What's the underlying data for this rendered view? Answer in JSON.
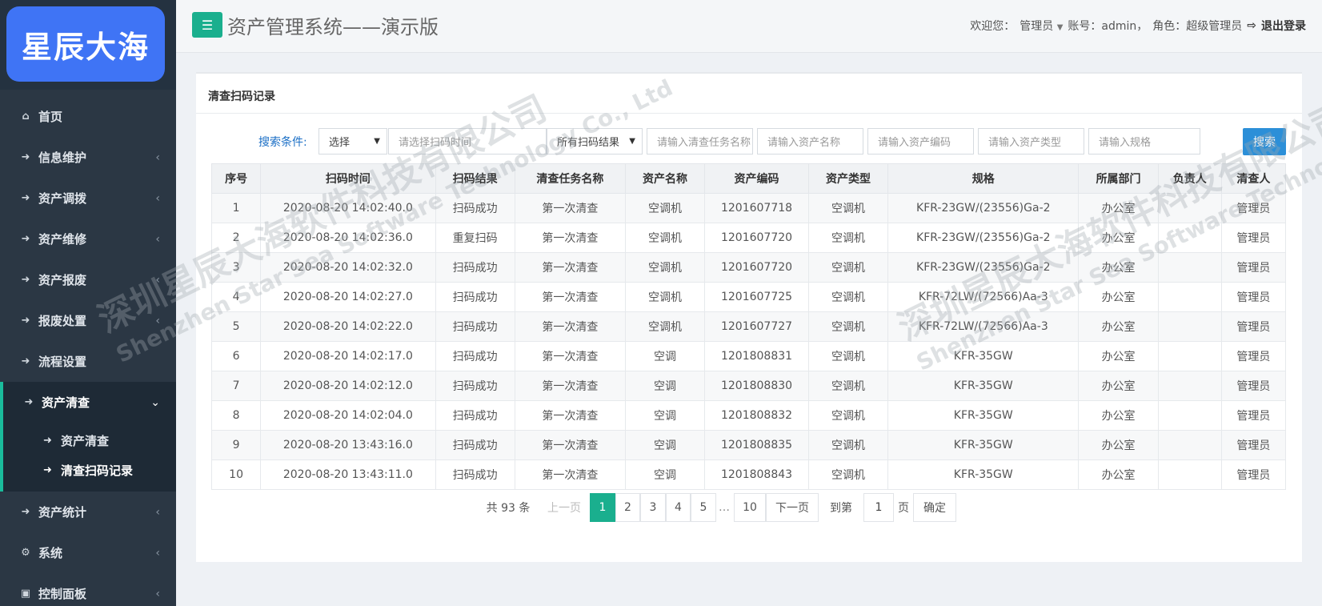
{
  "app": {
    "logo_text": "星辰大海",
    "title": "资产管理系统——演示版"
  },
  "header": {
    "welcome_prefix": "欢迎您：",
    "user_name": "管理员",
    "account_text": "账号：admin，",
    "role_text": "角色：超级管理员",
    "logout_label": "退出登录"
  },
  "sidebar": {
    "items": [
      {
        "label": "首页",
        "icon": "home-icon"
      },
      {
        "label": "信息维护",
        "icon": "arrow-right-icon"
      },
      {
        "label": "资产调拨",
        "icon": "arrow-right-icon"
      },
      {
        "label": "资产维修",
        "icon": "arrow-right-icon"
      },
      {
        "label": "资产报废",
        "icon": "arrow-right-icon"
      },
      {
        "label": "报废处置",
        "icon": "arrow-right-icon"
      },
      {
        "label": "流程设置",
        "icon": "arrow-right-icon"
      },
      {
        "label": "资产清查",
        "icon": "arrow-right-icon",
        "expanded": true
      },
      {
        "label": "资产统计",
        "icon": "arrow-right-icon"
      },
      {
        "label": "系统",
        "icon": "gear-icon"
      },
      {
        "label": "控制面板",
        "icon": "monitor-icon"
      }
    ],
    "sub_items": [
      {
        "label": "资产清查"
      },
      {
        "label": "清查扫码记录",
        "current": true
      }
    ]
  },
  "panel": {
    "title": "清查扫码记录"
  },
  "search": {
    "label": "搜索条件:",
    "select_value": "选择",
    "time_placeholder": "请选择扫码时间",
    "result_select_value": "所有扫码结果",
    "task_placeholder": "请输入清查任务名称",
    "asset_name_placeholder": "请输入资产名称",
    "asset_code_placeholder": "请输入资产编码",
    "asset_type_placeholder": "请输入资产类型",
    "spec_placeholder": "请输入规格",
    "button_label": "搜索"
  },
  "table": {
    "columns": [
      "序号",
      "扫码时间",
      "扫码结果",
      "清查任务名称",
      "资产名称",
      "资产编码",
      "资产类型",
      "规格",
      "所属部门",
      "负责人",
      "清查人"
    ],
    "rows": [
      [
        "1",
        "2020-08-20 14:02:40.0",
        "扫码成功",
        "第一次清查",
        "空调机",
        "1201607718",
        "空调机",
        "KFR-23GW/(23556)Ga-2",
        "办公室",
        "",
        "管理员"
      ],
      [
        "2",
        "2020-08-20 14:02:36.0",
        "重复扫码",
        "第一次清查",
        "空调机",
        "1201607720",
        "空调机",
        "KFR-23GW/(23556)Ga-2",
        "办公室",
        "",
        "管理员"
      ],
      [
        "3",
        "2020-08-20 14:02:32.0",
        "扫码成功",
        "第一次清查",
        "空调机",
        "1201607720",
        "空调机",
        "KFR-23GW/(23556)Ga-2",
        "办公室",
        "",
        "管理员"
      ],
      [
        "4",
        "2020-08-20 14:02:27.0",
        "扫码成功",
        "第一次清查",
        "空调机",
        "1201607725",
        "空调机",
        "KFR-72LW/(72566)Aa-3",
        "办公室",
        "",
        "管理员"
      ],
      [
        "5",
        "2020-08-20 14:02:22.0",
        "扫码成功",
        "第一次清查",
        "空调机",
        "1201607727",
        "空调机",
        "KFR-72LW/(72566)Aa-3",
        "办公室",
        "",
        "管理员"
      ],
      [
        "6",
        "2020-08-20 14:02:17.0",
        "扫码成功",
        "第一次清查",
        "空调",
        "1201808831",
        "空调机",
        "KFR-35GW",
        "办公室",
        "",
        "管理员"
      ],
      [
        "7",
        "2020-08-20 14:02:12.0",
        "扫码成功",
        "第一次清查",
        "空调",
        "1201808830",
        "空调机",
        "KFR-35GW",
        "办公室",
        "",
        "管理员"
      ],
      [
        "8",
        "2020-08-20 14:02:04.0",
        "扫码成功",
        "第一次清查",
        "空调",
        "1201808832",
        "空调机",
        "KFR-35GW",
        "办公室",
        "",
        "管理员"
      ],
      [
        "9",
        "2020-08-20 13:43:16.0",
        "扫码成功",
        "第一次清查",
        "空调",
        "1201808835",
        "空调机",
        "KFR-35GW",
        "办公室",
        "",
        "管理员"
      ],
      [
        "10",
        "2020-08-20 13:43:11.0",
        "扫码成功",
        "第一次清查",
        "空调",
        "1201808843",
        "空调机",
        "KFR-35GW",
        "办公室",
        "",
        "管理员"
      ]
    ]
  },
  "pager": {
    "total_text": "共 93 条",
    "prev_label": "上一页",
    "pages": [
      "1",
      "2",
      "3",
      "4",
      "5"
    ],
    "current_page": "1",
    "ellipsis": "…",
    "last_page": "10",
    "next_label": "下一页",
    "goto_label": "到第",
    "goto_value": "1",
    "page_unit": "页",
    "confirm_label": "确定"
  },
  "watermark": {
    "cn": "深圳星辰大海软件科技有限公司",
    "en": "Shenzhen Star Sea Software Technology Co., Ltd"
  },
  "colors": {
    "sidebar_bg": "#2b3744",
    "accent_green": "#1aaf8e",
    "search_blue": "#2c8fd8",
    "logo_blue": "#3f74f5"
  }
}
